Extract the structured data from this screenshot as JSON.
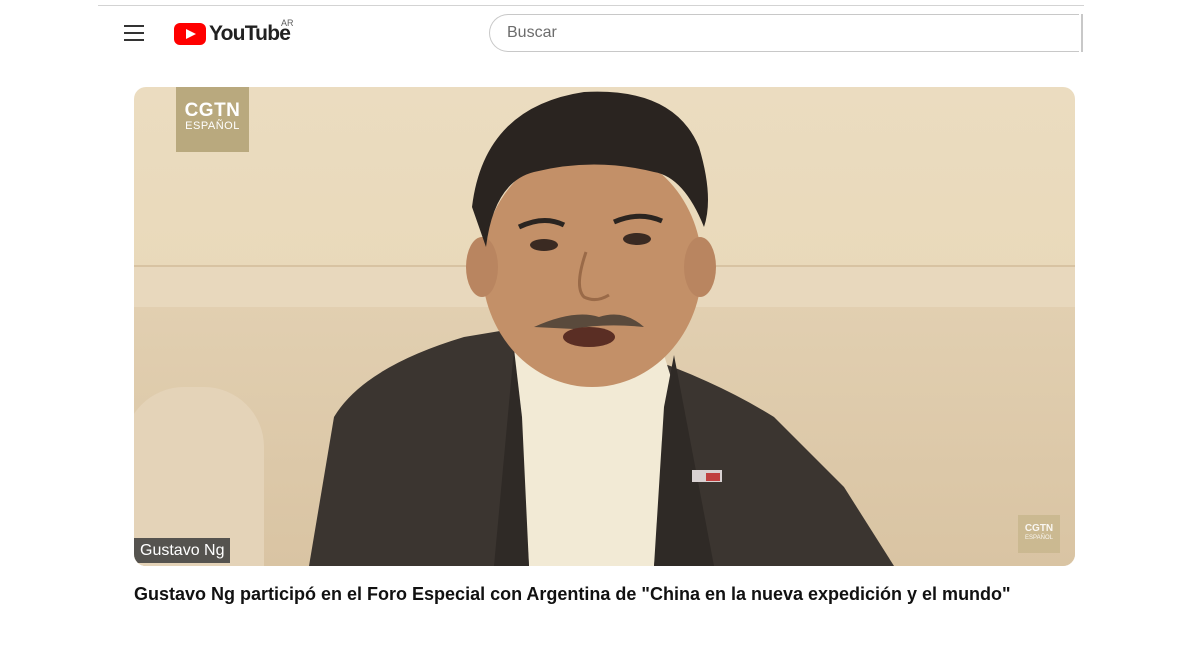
{
  "header": {
    "logo_text": "YouTube",
    "region_code": "AR",
    "search": {
      "placeholder": "Buscar",
      "value": ""
    }
  },
  "icons": {
    "menu": "hamburger-icon",
    "logo": "youtube-play-icon"
  },
  "video": {
    "channel_logo_line1": "CGTN",
    "channel_logo_line2": "ESPAÑOL",
    "name_tag": "Gustavo Ng",
    "title": "Gustavo Ng participó en el Foro Especial con Argentina de \"China en la nueva expedición y el mundo\""
  },
  "colors": {
    "brand_red": "#ff0000",
    "logo_gold": "#b9a97e"
  }
}
